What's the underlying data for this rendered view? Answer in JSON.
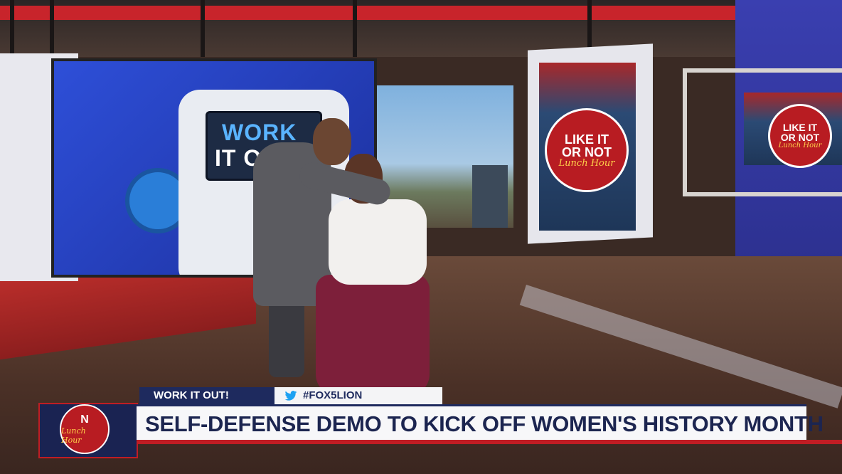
{
  "scene": {
    "video_wall": {
      "line1": "WORK",
      "line2": "IT OUT"
    },
    "promo_screen": {
      "line1": "LIKE IT",
      "line2": "OR NOT",
      "line3": "Lunch Hour"
    },
    "shelf_screen": {
      "line1": "LIKE IT",
      "line2": "OR NOT",
      "line3": "Lunch Hour"
    }
  },
  "lower_third": {
    "segment_tag": "WORK IT OUT!",
    "hashtag": "#FOX5LION",
    "hashtag_icon": "twitter-bird-icon",
    "headline": "SELF-DEFENSE DEMO TO KICK OFF WOMEN'S HISTORY MONTH",
    "logo_text_short": "N",
    "logo_script": "Lunch Hour"
  },
  "colors": {
    "brand_navy": "#1e2a5e",
    "brand_red": "#c01d24",
    "headline_bg": "#f7f7f9"
  }
}
